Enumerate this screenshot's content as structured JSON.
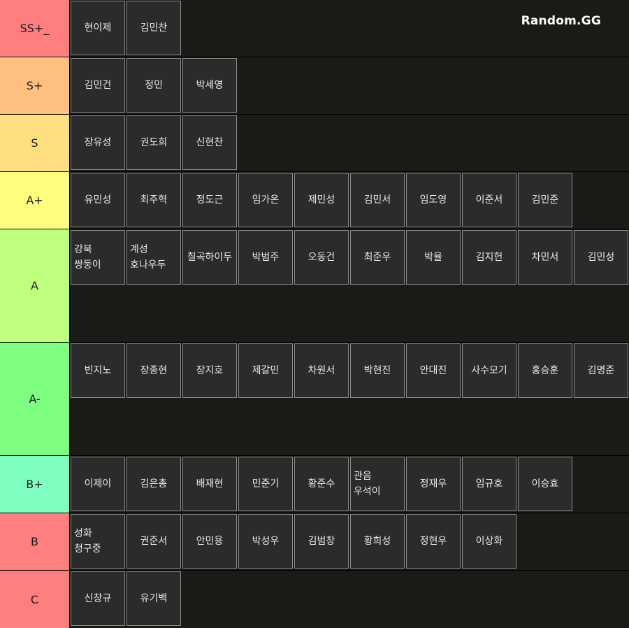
{
  "watermark": "Random.GG",
  "tiers": [
    {
      "label": "SS+_",
      "color": "#ff7f7f",
      "items": [
        "현이제",
        "김민찬"
      ]
    },
    {
      "label": "S+",
      "color": "#ffbf7f",
      "items": [
        "김민건",
        "정민",
        "박세영"
      ]
    },
    {
      "label": "S",
      "color": "#ffdf7f",
      "items": [
        "장유성",
        "권도희",
        "신현찬"
      ]
    },
    {
      "label": "A+",
      "color": "#ffff7f",
      "items": [
        "유민성",
        "최주혁",
        "정도근",
        "임가온",
        "제민성",
        "김민서",
        "임도영",
        "이준서",
        "김민준"
      ]
    },
    {
      "label": "A",
      "color": "#bfff7f",
      "items": [
        "강북 쌍둥이",
        "계성 호나우두",
        "칠곡하이두",
        "박범주",
        "오동건",
        "최준우",
        "박율",
        "김지헌",
        "차민서",
        "김민성"
      ]
    },
    {
      "label": "A-",
      "color": "#7fff7f",
      "items": [
        "빈지노",
        "장종현",
        "장지호",
        "제갈민",
        "차원서",
        "박현진",
        "안대진",
        "사수모기",
        "홍승훈",
        "김명준"
      ]
    },
    {
      "label": "B+",
      "color": "#7fffbf",
      "items": [
        "이제이",
        "김은총",
        "배재현",
        "민준기",
        "황준수",
        "관음 우석이",
        "정재우",
        "임규호",
        "이승효"
      ]
    },
    {
      "label": "B",
      "color": "#ff7f7f",
      "items": [
        "성화 청구중",
        "권준서",
        "안민용",
        "박성우",
        "김범창",
        "황희성",
        "정현우",
        "이상화"
      ]
    },
    {
      "label": "C",
      "color": "#ff7f7f",
      "items": [
        "신창규",
        "유기백"
      ]
    }
  ]
}
